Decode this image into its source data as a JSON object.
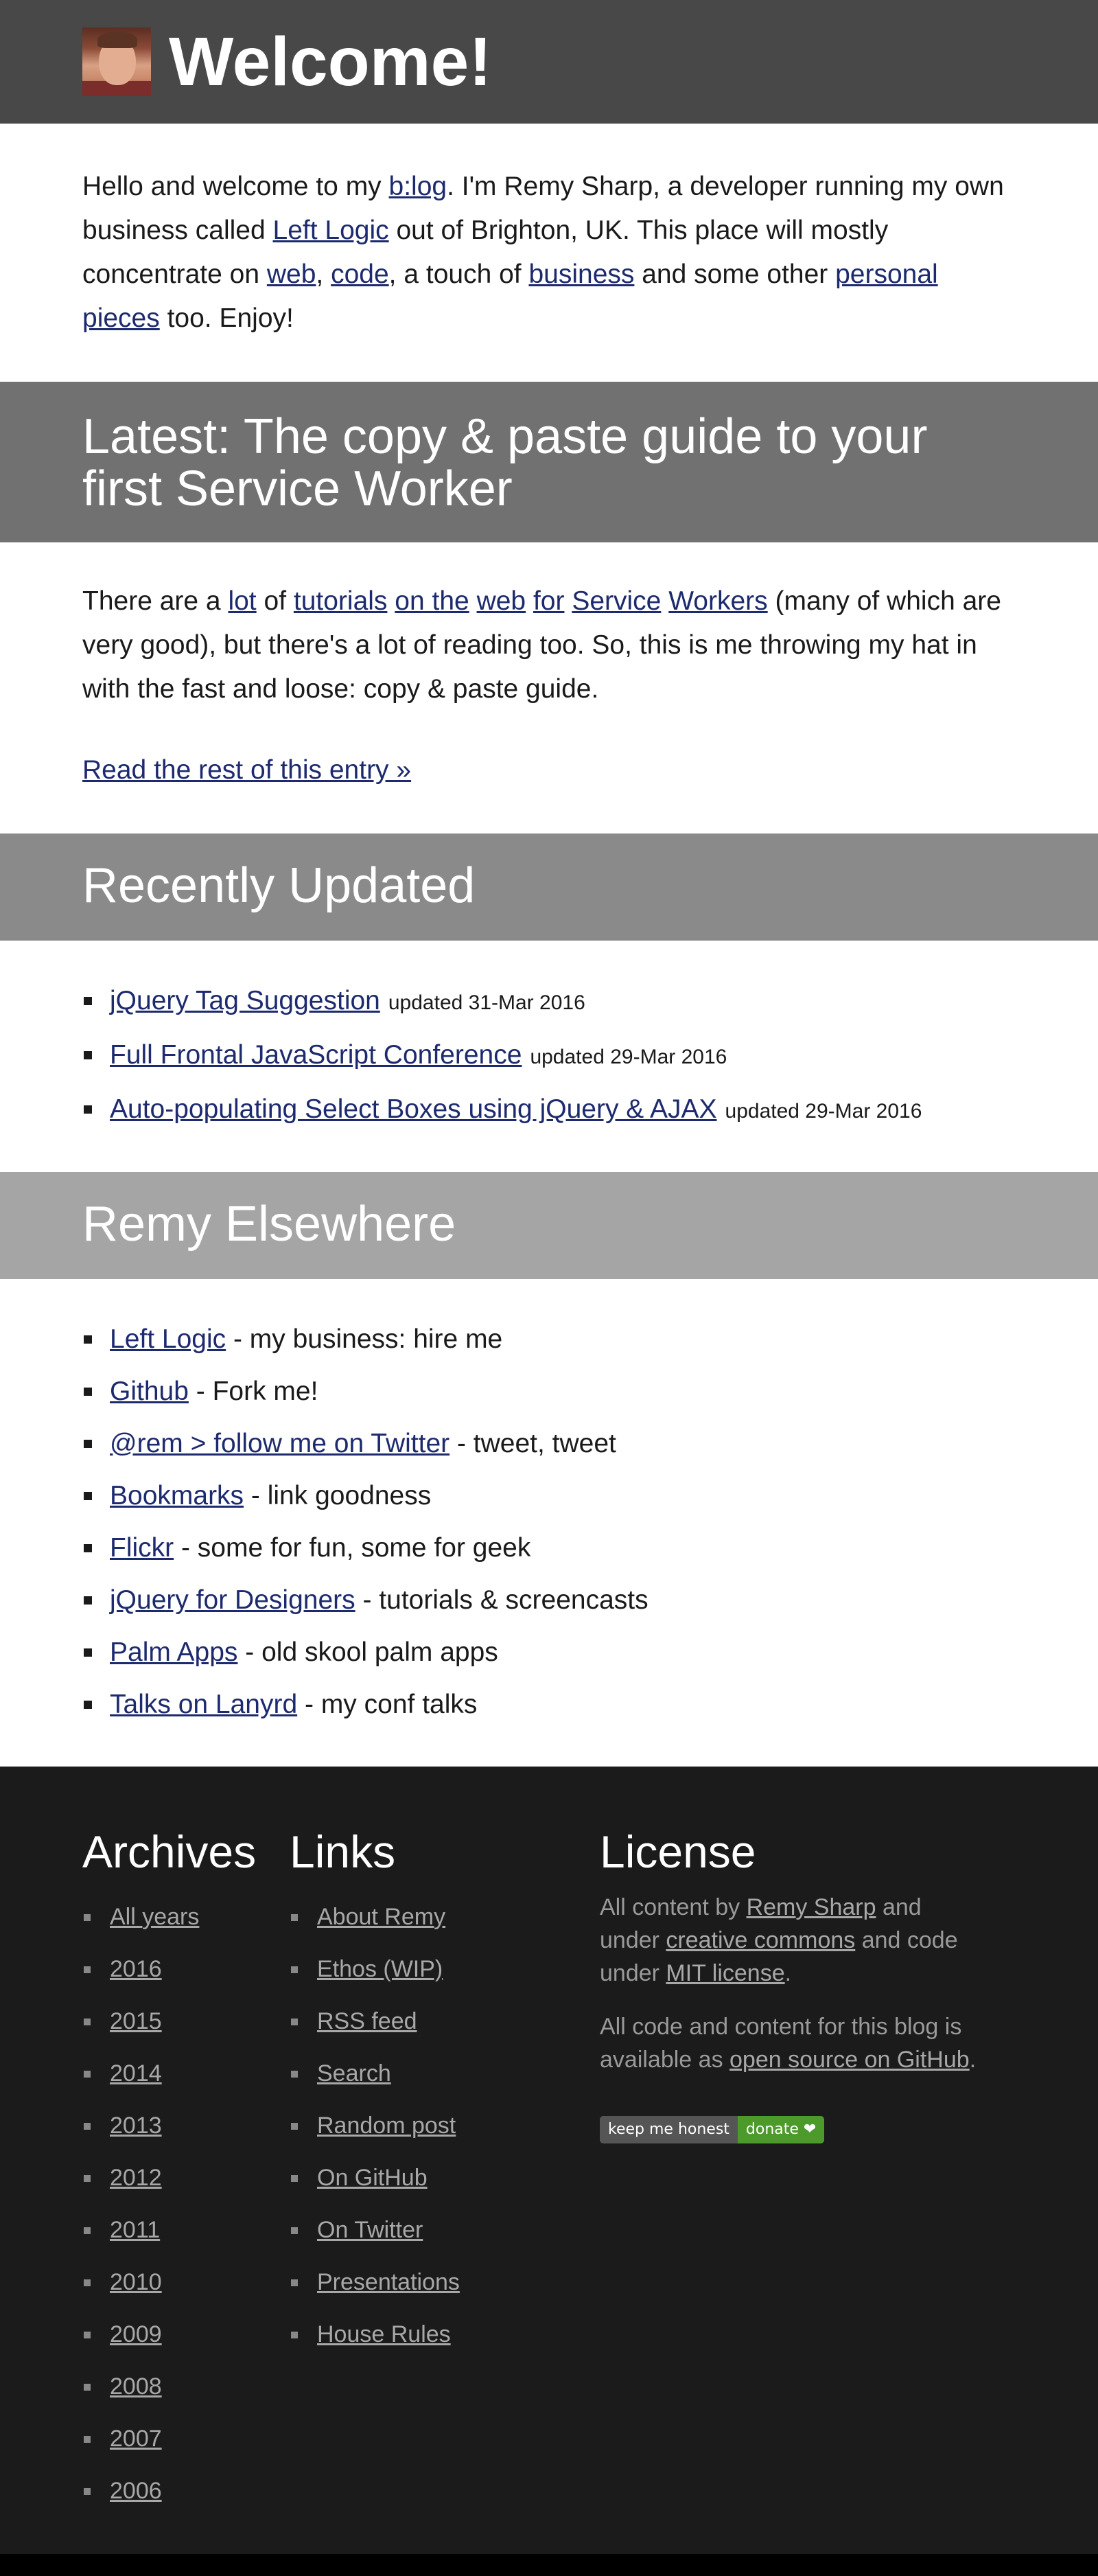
{
  "header": {
    "title": "Welcome!"
  },
  "intro": {
    "t1": "Hello and welcome to my ",
    "blog_link": "b:log",
    "t2": ". I'm Remy Sharp, a developer running my own business called ",
    "leftlogic_link": "Left Logic",
    "t3": " out of Brighton, UK. This place will mostly concentrate on ",
    "web_link": "web",
    "t4": ", ",
    "code_link": "code",
    "t5": ", a touch of ",
    "business_link": "business",
    "t6": " and some other ",
    "personal_link": "personal pieces",
    "t7": " too. Enjoy!"
  },
  "latest": {
    "heading": "Latest: The copy & paste guide to your first Service Worker",
    "p_start": "There are a ",
    "links": [
      "lot",
      "of",
      "tutorials",
      "on the",
      "web",
      "for",
      "Service",
      "Workers"
    ],
    "p_end": " (many of which are very good), but there's a lot of reading too. So, this is me throwing my hat in with the fast and loose: copy & paste guide.",
    "read_more": "Read the rest of this entry »"
  },
  "recent": {
    "heading": "Recently Updated",
    "items": [
      {
        "title": "jQuery Tag Suggestion",
        "updated": "updated 31-Mar 2016"
      },
      {
        "title": "Full Frontal JavaScript Conference",
        "updated": "updated 29-Mar 2016"
      },
      {
        "title": "Auto-populating Select Boxes using jQuery & AJAX",
        "updated": "updated 29-Mar 2016"
      }
    ]
  },
  "elsewhere": {
    "heading": "Remy Elsewhere",
    "items": [
      {
        "link": "Left Logic",
        "desc": " - my business: hire me"
      },
      {
        "link": "Github",
        "desc": " - Fork me!"
      },
      {
        "link": "@rem > follow me on Twitter",
        "desc": " - tweet, tweet"
      },
      {
        "link": "Bookmarks",
        "desc": " - link goodness"
      },
      {
        "link": "Flickr",
        "desc": " - some for fun, some for geek"
      },
      {
        "link": "jQuery for Designers",
        "desc": " - tutorials & screencasts"
      },
      {
        "link": "Palm Apps",
        "desc": " - old skool palm apps"
      },
      {
        "link": "Talks on Lanyrd",
        "desc": " - my conf talks"
      }
    ]
  },
  "footer": {
    "archives": {
      "heading": "Archives",
      "items": [
        "All years",
        "2016",
        "2015",
        "2014",
        "2013",
        "2012",
        "2011",
        "2010",
        "2009",
        "2008",
        "2007",
        "2006"
      ]
    },
    "links": {
      "heading": "Links",
      "items": [
        "About Remy",
        "Ethos (WIP)",
        "RSS feed",
        "Search",
        "Random post",
        "On GitHub",
        "On Twitter",
        "Presentations",
        "House Rules"
      ]
    },
    "license": {
      "heading": "License",
      "p1_a": "All content by ",
      "p1_link1": "Remy Sharp",
      "p1_b": " and under ",
      "p1_link2": "creative commons",
      "p1_c": " and code under ",
      "p1_link3": "MIT license",
      "p1_d": ".",
      "p2_a": "All code and content for this blog is available as ",
      "p2_link": "open source on GitHub",
      "p2_b": ".",
      "badge_left": "keep me honest",
      "badge_right": "donate ❤"
    }
  },
  "colors": {
    "header_bg": "#484848",
    "latest_bg": "#717171",
    "recent_bg": "#8a8a8a",
    "elsewhere_bg": "#a5a5a5",
    "footer_bg": "#1b1b1b",
    "link": "#1d2a6e",
    "donate_green": "#4c9a2a"
  }
}
